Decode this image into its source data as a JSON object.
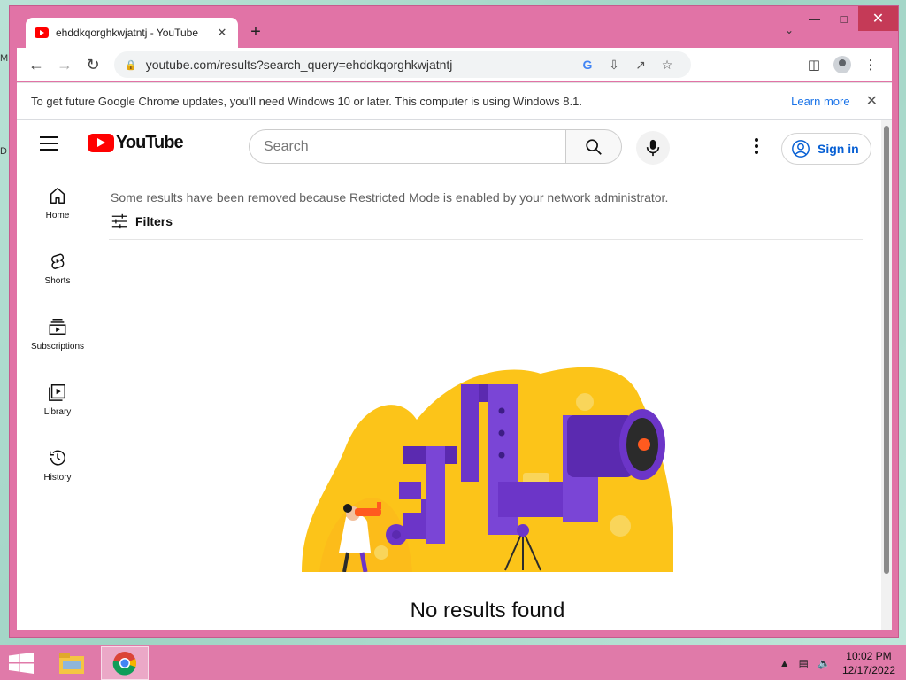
{
  "tab": {
    "title": "ehddkqorghkwjatntj - YouTube"
  },
  "toolbar": {
    "url": "youtube.com/results?search_query=ehddkqorghkwjatntj"
  },
  "infobar": {
    "message": "To get future Google Chrome updates, you'll need Windows 10 or later. This computer is using Windows 8.1.",
    "learn_more": "Learn more"
  },
  "youtube": {
    "logo_text": "YouTube",
    "search_placeholder": "Search",
    "sign_in": "Sign in",
    "guide": [
      {
        "label": "Home"
      },
      {
        "label": "Shorts"
      },
      {
        "label": "Subscriptions"
      },
      {
        "label": "Library"
      },
      {
        "label": "History"
      }
    ],
    "restricted_notice": "Some results have been removed because Restricted Mode is enabled by your network administrator.",
    "filters_label": "Filters",
    "no_results": "No results found"
  },
  "taskbar": {
    "time": "10:02 PM",
    "date": "12/17/2022"
  },
  "colors": {
    "youtube_red": "#ff0000",
    "link_blue": "#065fd4",
    "window_frame": "#e173a6",
    "illustration_yellow": "#fcc419",
    "illustration_purple": "#6c35c8"
  }
}
